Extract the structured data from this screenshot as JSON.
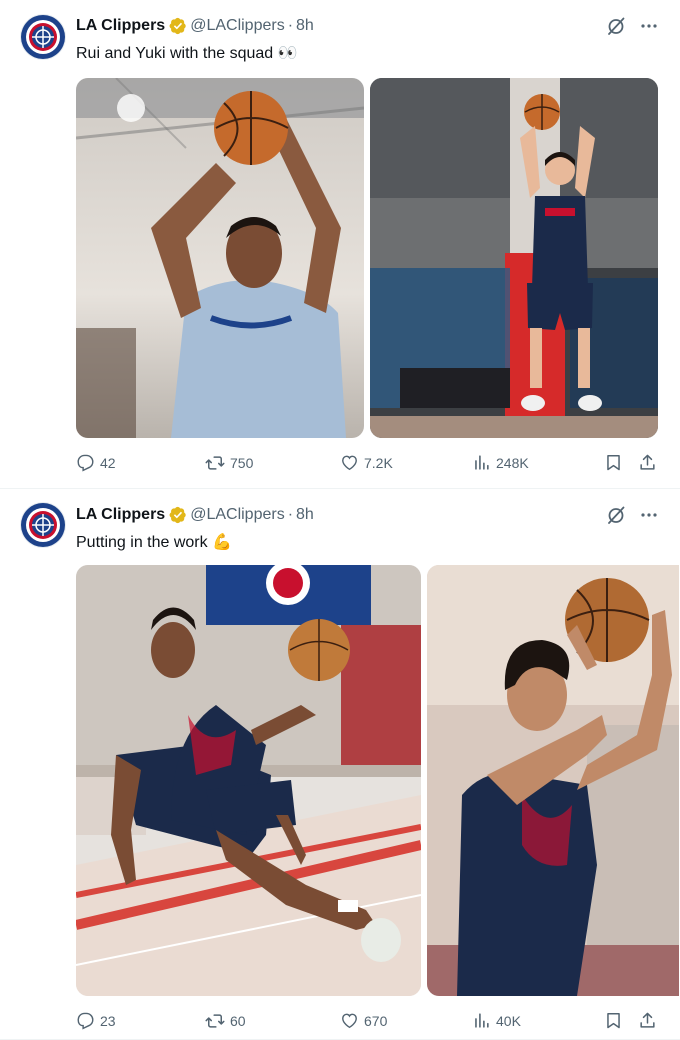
{
  "tweets": [
    {
      "author": {
        "name": "LA Clippers",
        "handle": "@LAClippers",
        "time": "8h"
      },
      "text": "Rui and Yuki with the squad 👀",
      "media": [
        {
          "alt": "Rui shooting a basketball in a light blue Clippers shirt"
        },
        {
          "alt": "Yuki shooting a jump shot on the practice court"
        }
      ],
      "metrics": {
        "replies": "42",
        "reposts": "750",
        "likes": "7.2K",
        "views": "248K"
      }
    },
    {
      "author": {
        "name": "LA Clippers",
        "handle": "@LAClippers",
        "time": "8h"
      },
      "text": "Putting in the work 💪",
      "media": [
        {
          "alt": "Player dribbling low on the practice court"
        },
        {
          "alt": "Player shooting a basketball in a navy jersey"
        }
      ],
      "metrics": {
        "replies": "23",
        "reposts": "60",
        "likes": "670",
        "views": "40K"
      }
    }
  ],
  "icons": [
    "verified-badge-icon",
    "grok-icon",
    "more-icon",
    "reply-icon",
    "repost-icon",
    "like-icon",
    "views-icon",
    "bookmark-icon",
    "share-icon"
  ],
  "colors": {
    "text": "#0f1419",
    "secondary": "#536471",
    "verified": "#e2b719",
    "divider": "#eff3f4"
  }
}
